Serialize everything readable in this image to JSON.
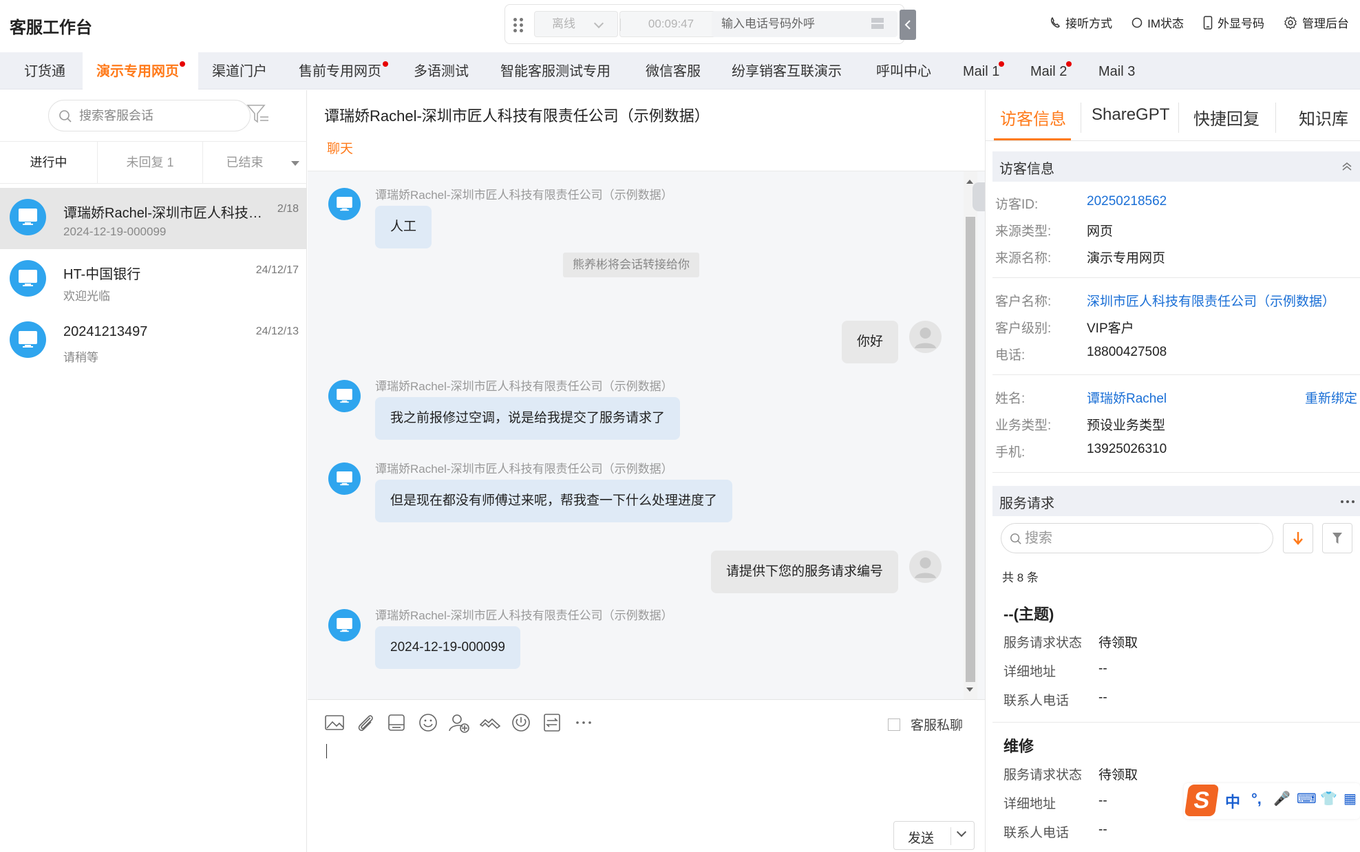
{
  "app": {
    "title": "客服工作台"
  },
  "callbar": {
    "status": "离线",
    "timer": "00:09:47",
    "dial_placeholder": "输入电话号码外呼"
  },
  "top_actions": {
    "answer_mode": "接听方式",
    "im_status": "IM状态",
    "display_number": "外显号码",
    "admin": "管理后台"
  },
  "tabs": [
    {
      "label": "订货通",
      "active": false,
      "dot": false
    },
    {
      "label": "演示专用网页",
      "active": true,
      "dot": true
    },
    {
      "label": "渠道门户",
      "active": false,
      "dot": false
    },
    {
      "label": "售前专用网页",
      "active": false,
      "dot": true
    },
    {
      "label": "多语测试",
      "active": false,
      "dot": false
    },
    {
      "label": "智能客服测试专用",
      "active": false,
      "dot": false
    },
    {
      "label": "微信客服",
      "active": false,
      "dot": false
    },
    {
      "label": "纷享销客互联演示",
      "active": false,
      "dot": false
    },
    {
      "label": "呼叫中心",
      "active": false,
      "dot": false
    },
    {
      "label": "Mail 1",
      "active": false,
      "dot": true
    },
    {
      "label": "Mail 2",
      "active": false,
      "dot": true
    },
    {
      "label": "Mail 3",
      "active": false,
      "dot": false
    }
  ],
  "left": {
    "search_placeholder": "搜索客服会话",
    "status_tabs": [
      "进行中",
      "未回复 1",
      "已结束"
    ],
    "conversations": [
      {
        "name": "谭瑞娇Rachel-深圳市匠人科技有限责任公司（示例数据）",
        "date": "2/18",
        "sub": "2024-12-19-000099",
        "selected": true
      },
      {
        "name": "HT-中国银行",
        "date": "24/12/17",
        "sub": "欢迎光临",
        "selected": false
      },
      {
        "name": "20241213497",
        "date": "24/12/13",
        "sub": "请稍等",
        "selected": false
      }
    ]
  },
  "chat": {
    "title": "谭瑞娇Rachel-深圳市匠人科技有限责任公司（示例数据）",
    "tab": "聊天",
    "sender": "谭瑞娇Rachel-深圳市匠人科技有限责任公司（示例数据）",
    "system_note": "熊养彬将会话转接给你",
    "messages": [
      {
        "from": "visitor",
        "text": "人工"
      },
      {
        "from": "agent",
        "text": "你好"
      },
      {
        "from": "visitor",
        "text": "我之前报修过空调，说是给我提交了服务请求了"
      },
      {
        "from": "visitor",
        "text": "但是现在都没有师傅过来呢，帮我查一下什么处理进度了"
      },
      {
        "from": "agent",
        "text": "请提供下您的服务请求编号"
      },
      {
        "from": "visitor",
        "text": "2024-12-19-000099"
      }
    ],
    "private_label": "客服私聊",
    "send_label": "发送"
  },
  "right": {
    "tabs": [
      "访客信息",
      "ShareGPT",
      "快捷回复",
      "知识库"
    ],
    "visitor_section": "访客信息",
    "visitor_fields": [
      {
        "k": "访客ID:",
        "v": "20250218562",
        "link": true
      },
      {
        "k": "来源类型:",
        "v": "网页",
        "link": false
      },
      {
        "k": "来源名称:",
        "v": "演示专用网页",
        "link": false
      }
    ],
    "customer_fields": [
      {
        "k": "客户名称:",
        "v": "深圳市匠人科技有限责任公司（示例数据）",
        "link": true
      },
      {
        "k": "客户级别:",
        "v": "VIP客户",
        "link": false
      },
      {
        "k": "电话:",
        "v": "18800427508",
        "link": false
      }
    ],
    "contact_fields": [
      {
        "k": "姓名:",
        "v": "谭瑞娇Rachel",
        "link": true
      },
      {
        "k": "业务类型:",
        "v": "预设业务类型",
        "link": false
      },
      {
        "k": "手机:",
        "v": "13925026310",
        "link": false
      }
    ],
    "rebind": "重新绑定",
    "service_section": "服务请求",
    "service_search_placeholder": "搜索",
    "service_count": "共 8 条",
    "requests": [
      {
        "title": "--(主题)",
        "rows": [
          {
            "k": "服务请求状态",
            "v": "待领取"
          },
          {
            "k": "详细地址",
            "v": "--"
          },
          {
            "k": "联系人电话",
            "v": "--"
          }
        ]
      },
      {
        "title": "维修",
        "rows": [
          {
            "k": "服务请求状态",
            "v": "待领取"
          },
          {
            "k": "详细地址",
            "v": "--"
          },
          {
            "k": "联系人电话",
            "v": "--"
          }
        ]
      }
    ]
  },
  "ime": {
    "items": [
      "中",
      "°,",
      "🎤",
      "⌨",
      "👕",
      "▦"
    ]
  },
  "colors": {
    "accent": "#ff7a1a",
    "link": "#1a6fd6",
    "avatar": "#2fa5ee",
    "dot": "#e60000"
  }
}
